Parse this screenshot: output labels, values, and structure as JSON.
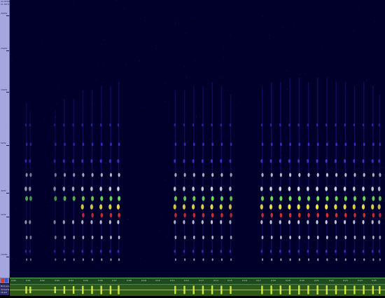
{
  "freq_axis": {
    "top_labels": [
      "22.050kHz",
      "21.5kHz"
    ],
    "labels": [
      {
        "text": "20kHz",
        "hz": 20000
      },
      {
        "text": "15kHz",
        "hz": 15000
      },
      {
        "text": "10kHz",
        "hz": 10000
      },
      {
        "text": "5kHz",
        "hz": 5000
      },
      {
        "text": "2kHz",
        "hz": 2000
      },
      {
        "text": "1kHz",
        "hz": 1000
      },
      {
        "text": "100Hz",
        "hz": 100
      }
    ]
  },
  "track_info": {
    "name": "Bird song",
    "rate": "44.1kHz",
    "format": "16-bit"
  },
  "time_ruler": {
    "labels": [
      "0:00",
      "0:01",
      "0:02",
      "0:03",
      "0:04",
      "0:05",
      "0:06",
      "0:07",
      "0:08",
      "0:09",
      "0:10",
      "0:11",
      "0:12",
      "0:13",
      "0:14",
      "0:15",
      "0:16",
      "0:17",
      "0:18",
      "0:19",
      "0:20",
      "0:21",
      "0:22",
      "0:23",
      "0:24",
      "0:25"
    ]
  },
  "colors": {
    "background": "#00001a",
    "low": "#2a1aa0",
    "mid": "#5a3cff",
    "high": "#ffffff",
    "peak_green": "#7dff5a",
    "peak_yellow": "#fff04a",
    "peak_red": "#ff3a2a",
    "waveform": "#d8f040"
  },
  "spectrogram": {
    "calls": [
      {
        "t": 0.037,
        "strength": 0.7
      },
      {
        "t": 0.048,
        "strength": 0.6
      },
      {
        "t": 0.115,
        "strength": 0.6
      },
      {
        "t": 0.14,
        "strength": 0.75
      },
      {
        "t": 0.165,
        "strength": 0.75
      },
      {
        "t": 0.19,
        "strength": 0.85
      },
      {
        "t": 0.215,
        "strength": 0.85
      },
      {
        "t": 0.24,
        "strength": 0.9
      },
      {
        "t": 0.265,
        "strength": 0.9
      },
      {
        "t": 0.287,
        "strength": 0.95
      },
      {
        "t": 0.44,
        "strength": 0.85
      },
      {
        "t": 0.465,
        "strength": 0.85
      },
      {
        "t": 0.49,
        "strength": 0.9
      },
      {
        "t": 0.515,
        "strength": 0.9
      },
      {
        "t": 0.54,
        "strength": 0.95
      },
      {
        "t": 0.565,
        "strength": 0.9
      },
      {
        "t": 0.59,
        "strength": 0.8
      },
      {
        "t": 0.675,
        "strength": 0.9
      },
      {
        "t": 0.7,
        "strength": 0.95
      },
      {
        "t": 0.725,
        "strength": 0.95
      },
      {
        "t": 0.75,
        "strength": 1.0
      },
      {
        "t": 0.775,
        "strength": 1.0
      },
      {
        "t": 0.8,
        "strength": 0.95
      },
      {
        "t": 0.825,
        "strength": 1.0
      },
      {
        "t": 0.85,
        "strength": 1.0
      },
      {
        "t": 0.875,
        "strength": 0.95
      },
      {
        "t": 0.9,
        "strength": 0.95
      },
      {
        "t": 0.925,
        "strength": 0.9
      },
      {
        "t": 0.95,
        "strength": 0.95
      },
      {
        "t": 0.975,
        "strength": 0.9
      },
      {
        "t": 0.993,
        "strength": 0.8
      }
    ]
  }
}
